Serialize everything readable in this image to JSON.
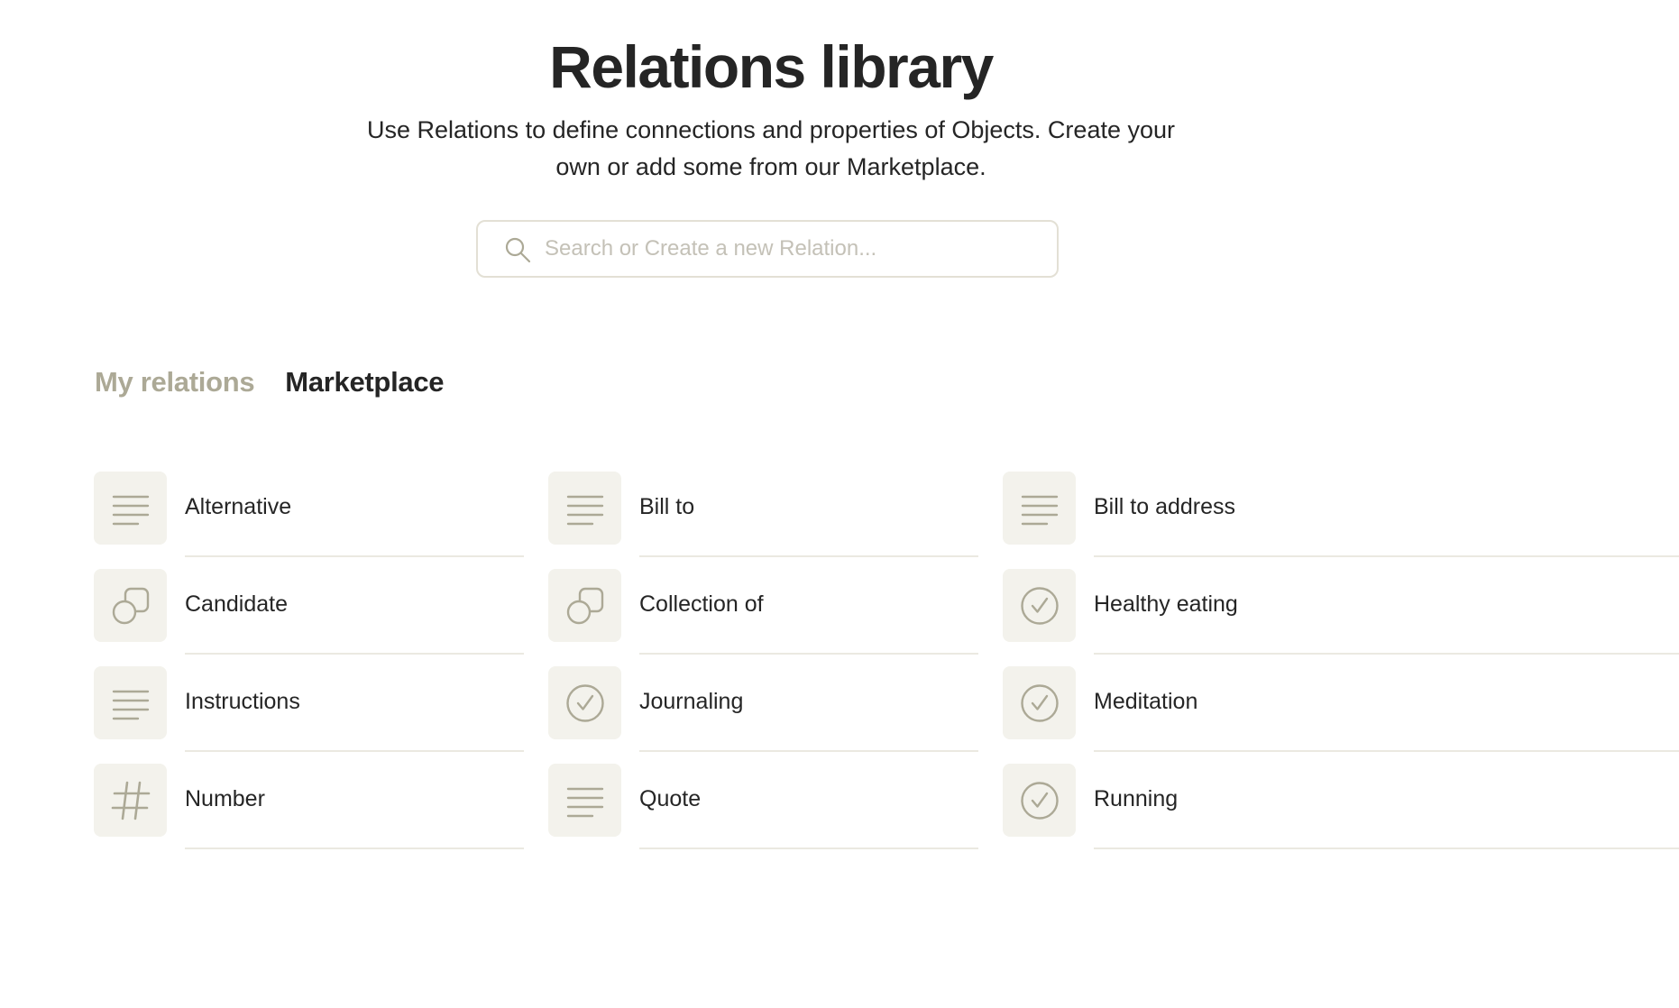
{
  "header": {
    "title": "Relations library",
    "subtitle": "Use Relations to define connections and properties of Objects. Create your own or add some from our Marketplace."
  },
  "search": {
    "placeholder": "Search or Create a new Relation...",
    "value": ""
  },
  "tabs": [
    {
      "label": "My relations",
      "active": false
    },
    {
      "label": "Marketplace",
      "active": true
    }
  ],
  "relations": [
    [
      {
        "label": "Alternative",
        "icon": "text-lines-icon"
      },
      {
        "label": "Candidate",
        "icon": "object-icon"
      },
      {
        "label": "Instructions",
        "icon": "text-lines-icon"
      },
      {
        "label": "Number",
        "icon": "hash-icon"
      }
    ],
    [
      {
        "label": "Bill to",
        "icon": "text-lines-icon"
      },
      {
        "label": "Collection of",
        "icon": "object-icon"
      },
      {
        "label": "Journaling",
        "icon": "checkbox-icon"
      },
      {
        "label": "Quote",
        "icon": "text-lines-icon"
      }
    ],
    [
      {
        "label": "Bill to address",
        "icon": "text-lines-icon"
      },
      {
        "label": "Healthy eating",
        "icon": "checkbox-icon"
      },
      {
        "label": "Meditation",
        "icon": "checkbox-icon"
      },
      {
        "label": "Running",
        "icon": "checkbox-icon"
      }
    ]
  ],
  "colors": {
    "text": "#252525",
    "muted_tab": "#aca996",
    "icon_stroke": "#aca996",
    "icon_bg": "#f3f2ec",
    "divider": "#ebe9e1",
    "search_border": "#e3e0d5",
    "placeholder": "#c4c1b7"
  }
}
